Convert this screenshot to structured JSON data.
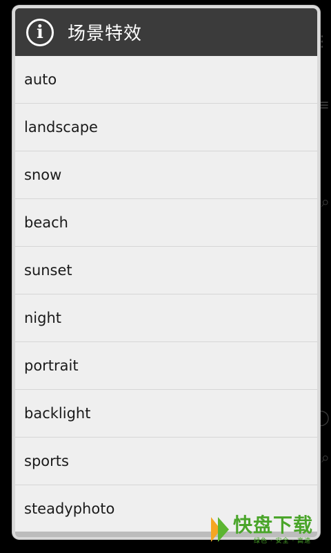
{
  "dialog": {
    "title": "场景特效",
    "icon": "info-icon",
    "items": [
      {
        "label": "auto"
      },
      {
        "label": "landscape"
      },
      {
        "label": "snow"
      },
      {
        "label": "beach"
      },
      {
        "label": "sunset"
      },
      {
        "label": "night"
      },
      {
        "label": "portrait"
      },
      {
        "label": "backlight"
      },
      {
        "label": "sports"
      },
      {
        "label": "steadyphoto"
      }
    ]
  },
  "watermark": {
    "main_a": "快",
    "main_b": "盘下载",
    "sub": "绿色 · 安全 · 高速"
  },
  "colors": {
    "title_bar": "#3b3b3b",
    "list_bg": "#efefef",
    "watermark_orange": "#f5a623",
    "watermark_green": "#4aa52a"
  }
}
